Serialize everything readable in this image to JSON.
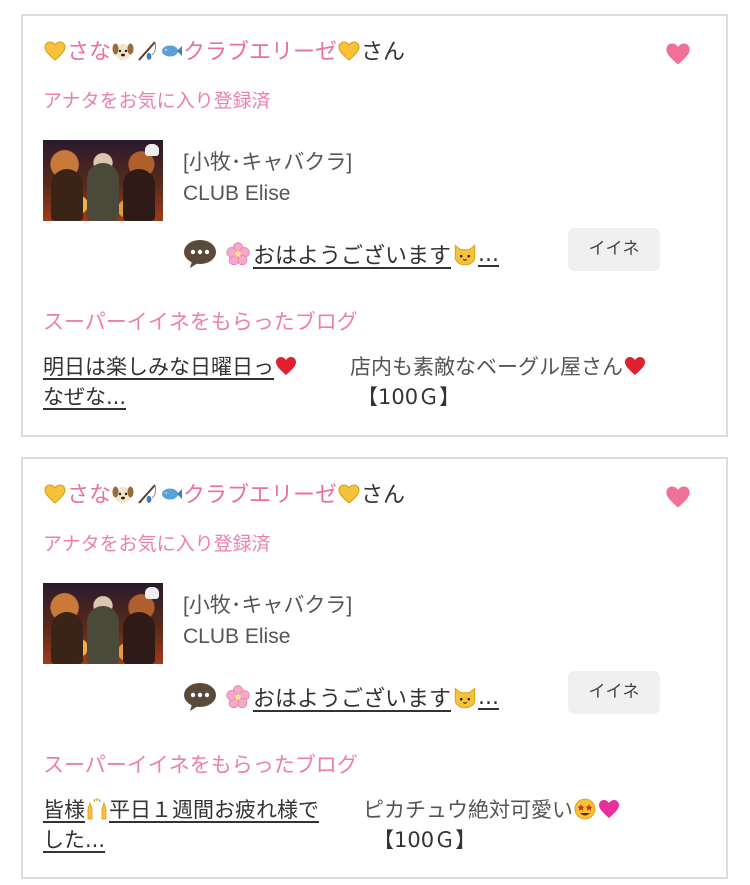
{
  "colors": {
    "accent_pink": "#ec7fae",
    "heart_pink": "#f07098",
    "border": "#dcdcdc",
    "button_bg": "#f0f0f0"
  },
  "cards": [
    {
      "user_name": "さな",
      "user_shop_name": "クラブエリーゼ",
      "name_suffix": "さん",
      "name_icons": [
        "yellow-heart-icon",
        "dog-face-icon",
        "fishing-pole-icon",
        "fish-icon",
        "yellow-heart-icon"
      ],
      "fav_status": "アナタをお気に入り登録済",
      "shop_category": "[小牧･キャバクラ]",
      "shop_name": "CLUB Elise",
      "message": "おはようございます",
      "message_ellipsis": "...",
      "iine_label": "イイネ",
      "super_heading": "スーパーイイネをもらったブログ",
      "blog_title": "明日は楽しみな日曜日っ",
      "blog_title_tail": "なぜな...",
      "blog_desc": "店内も素敵なベーグル屋さん",
      "blog_reward": "【100Ｇ】"
    },
    {
      "user_name": "さな",
      "user_shop_name": "クラブエリーゼ",
      "name_suffix": "さん",
      "name_icons": [
        "yellow-heart-icon",
        "dog-face-icon",
        "fishing-pole-icon",
        "fish-icon",
        "yellow-heart-icon"
      ],
      "fav_status": "アナタをお気に入り登録済",
      "shop_category": "[小牧･キャバクラ]",
      "shop_name": "CLUB Elise",
      "message": "おはようございます",
      "message_ellipsis": "...",
      "iine_label": "イイネ",
      "super_heading": "スーパーイイネをもらったブログ",
      "blog_title": "皆様",
      "blog_title_mid": "平日１週間お疲れ様で",
      "blog_title_tail": "した...",
      "blog_desc": "ピカチュウ絶対可愛い",
      "blog_reward": "【100Ｇ】"
    }
  ]
}
